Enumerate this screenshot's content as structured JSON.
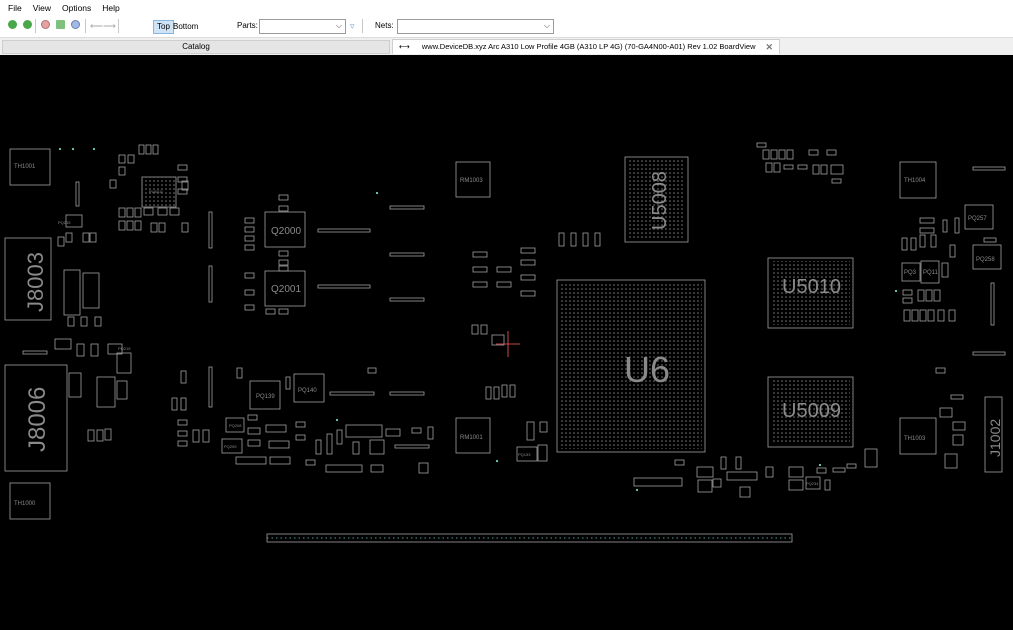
{
  "menu": {
    "file": "File",
    "view": "View",
    "options": "Options",
    "help": "Help"
  },
  "toolbar": {
    "top_label": "Top",
    "bottom_label": "Bottom",
    "parts_label": "Parts:",
    "parts_value": "",
    "nets_label": "Nets:",
    "nets_value": ""
  },
  "tabs": {
    "catalog": "Catalog",
    "document": "www.DeviceDB.xyz Arc A310 Low Profile 4GB (A310 LP 4G) (70-GA4N00-A01) Rev 1.02 BoardView"
  },
  "icons": {
    "nav_forward": "green-circle-arrow-icon",
    "nav_back": "green-circle-arrow-icon",
    "zoom_in": "zoom-in-icon",
    "zoom_fit": "zoom-fit-icon",
    "zoom_out": "zoom-out-icon",
    "filter": "filter-icon",
    "pin": "pin-icon",
    "close": "close-icon"
  },
  "colors": {
    "board_bg": "#000000",
    "outline": "#a0a0a0",
    "pad": "#6fd0c8",
    "label": "#8a8a8a",
    "cursor": "#ff5a5a"
  },
  "board": {
    "big_labels": [
      {
        "text": "U6"
      },
      {
        "text": "U5010"
      },
      {
        "text": "U5009"
      },
      {
        "text": "U5008"
      },
      {
        "text": "J8003"
      },
      {
        "text": "J8006"
      },
      {
        "text": "J1002"
      }
    ],
    "mid_labels": [
      {
        "text": "Q2000"
      },
      {
        "text": "Q2001"
      }
    ],
    "small_labels": [
      {
        "text": "TH1001"
      },
      {
        "text": "TH1000"
      },
      {
        "text": "TH1004"
      },
      {
        "text": "TH1003"
      },
      {
        "text": "RM1003"
      },
      {
        "text": "RM1001"
      },
      {
        "text": "PQ139"
      },
      {
        "text": "PQ140"
      },
      {
        "text": "PQ257"
      },
      {
        "text": "PQ258"
      },
      {
        "text": "PQ3"
      },
      {
        "text": "PQ11"
      },
      {
        "text": "PQ208"
      },
      {
        "text": "PQ209"
      },
      {
        "text": "PQ153"
      },
      {
        "text": "PU6011"
      },
      {
        "text": "PQ215"
      },
      {
        "text": "PQ215"
      },
      {
        "text": "PQ234"
      }
    ]
  }
}
